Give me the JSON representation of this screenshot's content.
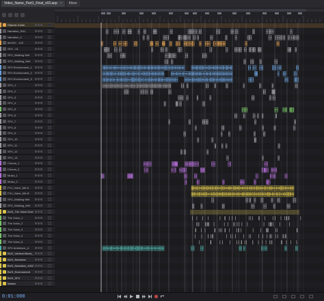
{
  "window": {
    "tabs": [
      {
        "label": "Video_Name_Part1_Final_v03.aep",
        "active": true
      },
      {
        "label": "Mixer",
        "active": false
      }
    ]
  },
  "colors": {
    "background": "#1b1b1e",
    "track_header": "#232327",
    "playhead": "#ffffff",
    "marker": "#8a8a95",
    "timecode": "#7fb3ff",
    "clip_gray": "#9a9aa0",
    "clip_blue": "#6a9ed6",
    "clip_green": "#7ac46a",
    "clip_purple": "#b56fd8",
    "clip_yellow": "#d9c24a",
    "clip_orange": "#e0a050",
    "clip_teal": "#4fb0a8"
  },
  "tracks": [
    {
      "name": "Objects Guide",
      "color": "#e0a050",
      "kind": "folder",
      "selected": true
    },
    {
      "name": "Narration_RA1",
      "color": "#9a9aa0",
      "kind": "audio"
    },
    {
      "name": "Narration_2",
      "color": "#9a9aa0",
      "kind": "audio"
    },
    {
      "name": "MUSIC - 120",
      "color": "#e0a050",
      "kind": "audio"
    },
    {
      "name": "SFX - 01",
      "color": "#9a9aa0",
      "kind": "audio"
    },
    {
      "name": "SFX_Walking Wet",
      "color": "#9a9aa0",
      "kind": "audio"
    },
    {
      "name": "SFX_Walking_Wet",
      "color": "#9a9aa0",
      "kind": "audio"
    },
    {
      "name": "SFX Environment_1",
      "color": "#6a9ed6",
      "kind": "audio"
    },
    {
      "name": "SFX Environment_2",
      "color": "#6a9ed6",
      "kind": "audio"
    },
    {
      "name": "SFX Environment_3",
      "color": "#6a9ed6",
      "kind": "audio"
    },
    {
      "name": "SFX_1",
      "color": "#9a9aa0",
      "kind": "audio"
    },
    {
      "name": "SFX_2",
      "color": "#9a9aa0",
      "kind": "audio"
    },
    {
      "name": "SFX_3",
      "color": "#9a9aa0",
      "kind": "audio"
    },
    {
      "name": "SFX_4",
      "color": "#9a9aa0",
      "kind": "audio"
    },
    {
      "name": "SFX_5",
      "color": "#7ac46a",
      "kind": "audio"
    },
    {
      "name": "SFX_6",
      "color": "#9a9aa0",
      "kind": "audio"
    },
    {
      "name": "SFX_7",
      "color": "#9a9aa0",
      "kind": "audio"
    },
    {
      "name": "SFX_8",
      "color": "#9a9aa0",
      "kind": "audio"
    },
    {
      "name": "SFX_9",
      "color": "#9a9aa0",
      "kind": "audio"
    },
    {
      "name": "SFX_10",
      "color": "#9a9aa0",
      "kind": "audio"
    },
    {
      "name": "SFX_11",
      "color": "#9a9aa0",
      "kind": "audio"
    },
    {
      "name": "SFX_12",
      "color": "#9a9aa0",
      "kind": "audio"
    },
    {
      "name": "SFX_13",
      "color": "#9a9aa0",
      "kind": "audio"
    },
    {
      "name": "Chorus_1",
      "color": "#b56fd8",
      "kind": "audio"
    },
    {
      "name": "Chorus_2",
      "color": "#b56fd8",
      "kind": "audio"
    },
    {
      "name": "Music_1",
      "color": "#b56fd8",
      "kind": "audio"
    },
    {
      "name": "Music_2",
      "color": "#b56fd8",
      "kind": "audio"
    },
    {
      "name": "FX1_Voice_Mix A",
      "color": "#d9c24a",
      "kind": "audio"
    },
    {
      "name": "FX1_Voice_Mix B",
      "color": "#d9c24a",
      "kind": "audio"
    },
    {
      "name": "SFX_Walking Wet",
      "color": "#9a9aa0",
      "kind": "audio"
    },
    {
      "name": "SFX_Walking_Wet",
      "color": "#9a9aa0",
      "kind": "audio"
    },
    {
      "name": "BUS_The Voice Evening",
      "color": "#d9c24a",
      "kind": "folder"
    },
    {
      "name": "The Voice_1",
      "color": "#7ac46a",
      "kind": "audio"
    },
    {
      "name": "The Voice_2",
      "color": "#7ac46a",
      "kind": "audio"
    },
    {
      "name": "The Voice_3",
      "color": "#7ac46a",
      "kind": "audio"
    },
    {
      "name": "The Voice_4",
      "color": "#7ac46a",
      "kind": "audio"
    },
    {
      "name": "The Voice_5",
      "color": "#7ac46a",
      "kind": "audio"
    },
    {
      "name": "SFX Ambience_A",
      "color": "#4fb0a8",
      "kind": "audio"
    },
    {
      "name": "BUS_Vertical Mixed_1002",
      "color": "#d9c24a",
      "kind": "folder"
    },
    {
      "name": "BUS_Narration",
      "color": "#d9c24a",
      "kind": "folder"
    },
    {
      "name": "BUS_Narration_1002",
      "color": "#d9c24a",
      "kind": "folder"
    },
    {
      "name": "BUS_Environment",
      "color": "#d9c24a",
      "kind": "folder"
    },
    {
      "name": "BUS_SFX",
      "color": "#d9c24a",
      "kind": "folder"
    },
    {
      "name": "Master",
      "color": "#d9c24a",
      "kind": "folder"
    }
  ],
  "transport": {
    "timecode": "0:01:000",
    "controls": [
      "go-to-start-icon",
      "rewind-icon",
      "play-icon",
      "stop-icon",
      "fast-forward-icon",
      "go-to-end-icon",
      "record-icon",
      "loop-icon"
    ],
    "right_tools": [
      "zoom-in-icon",
      "zoom-out-icon",
      "zoom-fit-icon",
      "snap-icon",
      "grid-icon"
    ]
  }
}
